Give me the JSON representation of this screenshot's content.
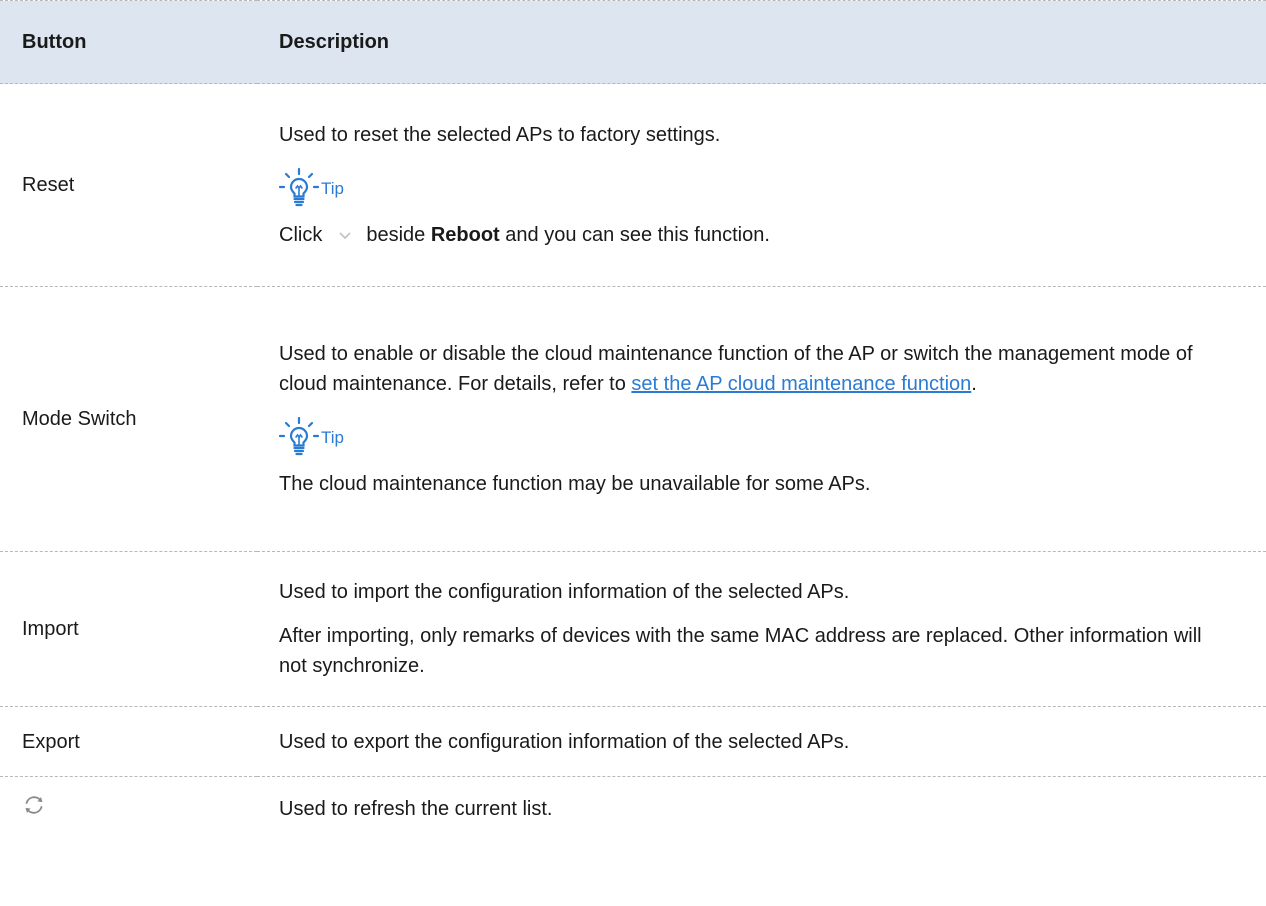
{
  "header": {
    "button": "Button",
    "description": "Description"
  },
  "rows": {
    "reset": {
      "button": "Reset",
      "desc": "Used to reset the selected APs to factory settings.",
      "tip_label": "Tip",
      "tip_pre": "Click",
      "tip_mid": "beside",
      "tip_bold": "Reboot",
      "tip_post": " and you can see this function."
    },
    "mode_switch": {
      "button": "Mode Switch",
      "desc_pre": "Used to enable or disable the cloud maintenance function of the AP or switch the management mode of cloud maintenance. For details, refer to ",
      "desc_link": "set the AP cloud maintenance function",
      "desc_post": ".",
      "tip_label": "Tip",
      "tip_text": "The cloud maintenance function may be unavailable for some APs."
    },
    "import": {
      "button": "Import",
      "desc1": "Used to import the configuration information of the selected APs.",
      "desc2": "After importing, only remarks of devices with the same MAC address are replaced. Other information will not synchronize."
    },
    "export": {
      "button": "Export",
      "desc": "Used to export the configuration information of the selected APs."
    },
    "refresh": {
      "icon": "refresh-icon",
      "desc": "Used to refresh the current list."
    }
  },
  "colors": {
    "header_bg": "#dde5f0",
    "accent": "#2a7bd4",
    "divider": "#b8b8b8"
  }
}
